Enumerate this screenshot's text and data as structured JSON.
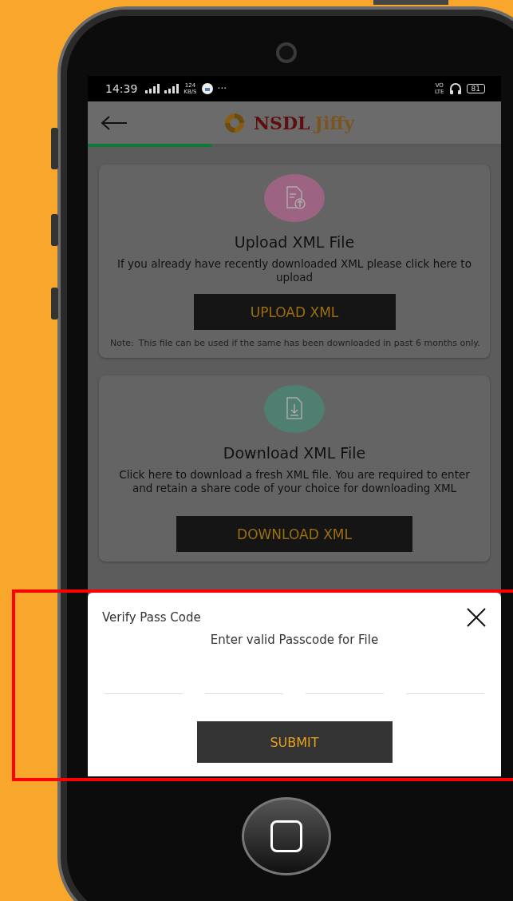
{
  "status_bar": {
    "time": "14:39",
    "network_speed": "124",
    "speed_unit": "KB/S",
    "more": "···",
    "volte_top": "VO",
    "volte_bottom": "LTE",
    "battery": "81"
  },
  "header": {
    "logo_text": "NSDL",
    "logo_accent": "Jiffy"
  },
  "progress": {
    "level": 0.3
  },
  "cards": [
    {
      "kind": "upload",
      "color": "#9c6482",
      "title": "Upload XML File",
      "description": "If you already have recently downloaded XML please click here to upload",
      "button": "UPLOAD XML",
      "note_label": "Note:",
      "note": "This file can be used if the same has been downloaded in past 6 months only."
    },
    {
      "kind": "download",
      "color": "#4f7f70",
      "title": "Download XML File",
      "description": "Click here to download a fresh XML file. You are required to enter and retain a share code of your choice for downloading XML",
      "button": "DOWNLOAD XML"
    }
  ],
  "dialog": {
    "title": "Verify Pass Code",
    "message": "Enter valid Passcode for File",
    "fields": [
      {
        "focused": false
      },
      {
        "focused": false
      },
      {
        "focused": false
      },
      {
        "focused": false
      }
    ],
    "button": "SUBMIT"
  }
}
